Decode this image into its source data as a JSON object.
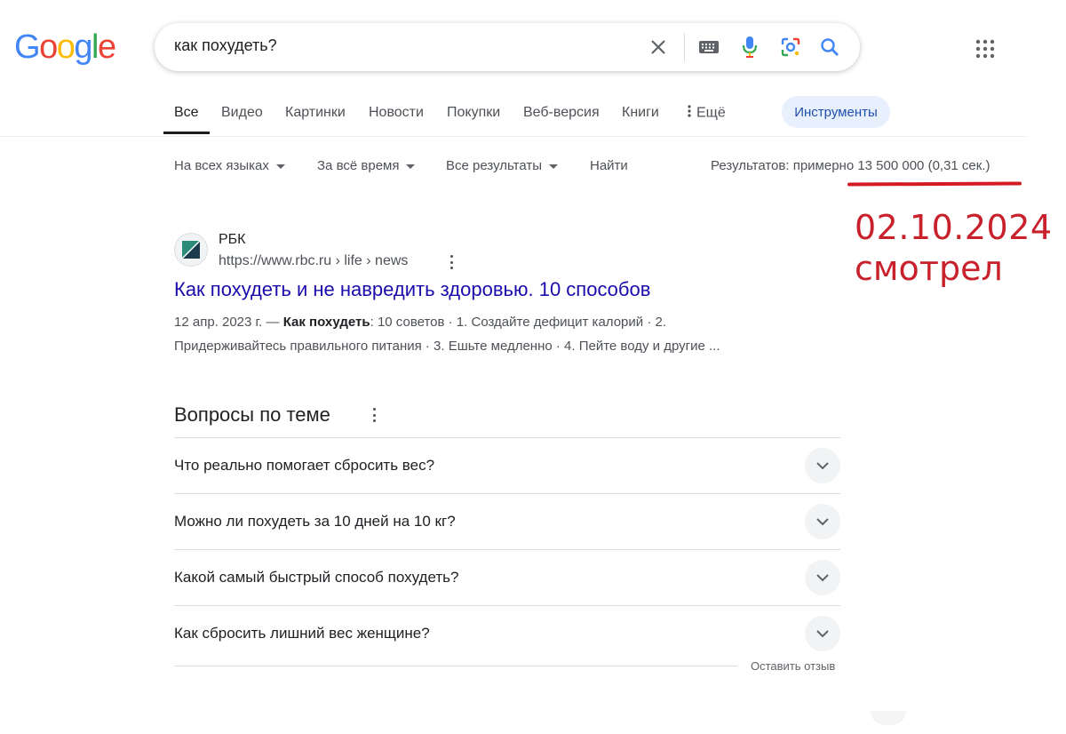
{
  "brand": {
    "logo_letters": [
      "G",
      "o",
      "o",
      "g",
      "l",
      "e"
    ],
    "logo_colors": [
      "#4285F4",
      "#EA4335",
      "#FBBC05",
      "#4285F4",
      "#34A853",
      "#EA4335"
    ]
  },
  "search": {
    "query": "как похудеть?",
    "icons": [
      "close-icon",
      "keyboard-icon",
      "microphone-icon",
      "lens-icon",
      "search-icon"
    ]
  },
  "tabs": [
    {
      "label": "Все",
      "active": true
    },
    {
      "label": "Видео"
    },
    {
      "label": "Картинки"
    },
    {
      "label": "Новости"
    },
    {
      "label": "Покупки"
    },
    {
      "label": "Веб-версия"
    },
    {
      "label": "Книги"
    },
    {
      "label": "Ещё"
    }
  ],
  "tools_label": "Инструменты",
  "filters": {
    "language": "На всех языках",
    "time": "За всё время",
    "results": "Все результаты",
    "find": "Найти"
  },
  "stats": "Результатов: примерно 13 500 000 (0,31 сек.)",
  "annotation": {
    "date": "02.10.2024",
    "note": "смотрел",
    "color": "#c8212b"
  },
  "result": {
    "site_name": "РБК",
    "url": "https://www.rbc.ru › life › news",
    "title": "Как похудеть и не навредить здоровью. 10 способов",
    "snippet_date": "12 апр. 2023 г. — ",
    "snippet_bold": "Как похудеть",
    "snippet_rest": ": 10 советов · 1. Создайте дефицит калорий · 2. Придерживайтесь правильного питания · 3. Ешьте медленно · 4. Пейте воду и другие ..."
  },
  "paa": {
    "title": "Вопросы по теме",
    "questions": [
      "Что реально помогает сбросить вес?",
      "Можно ли похудеть за 10 дней на 10 кг?",
      "Какой самый быстрый способ похудеть?",
      "Как сбросить лишний вес женщине?"
    ]
  },
  "feedback": "Оставить отзыв"
}
